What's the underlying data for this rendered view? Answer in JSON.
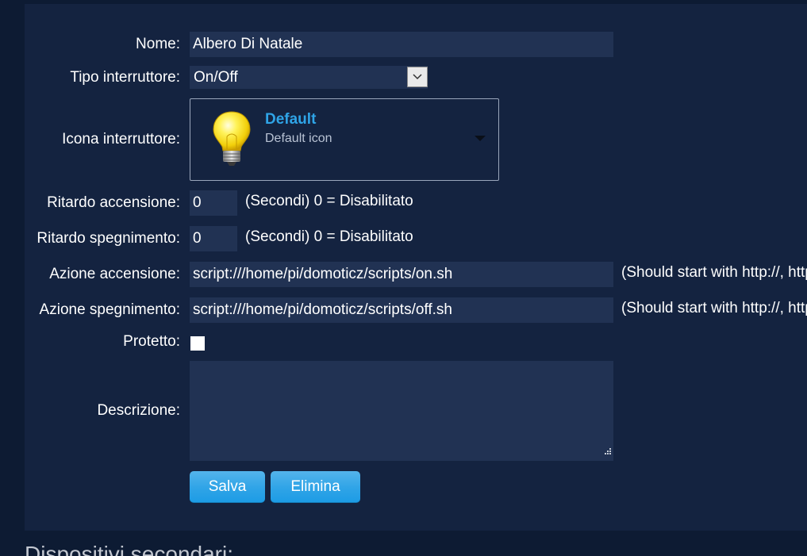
{
  "form": {
    "name_label": "Nome:",
    "name_value": "Albero Di Natale",
    "type_label": "Tipo interruttore:",
    "type_value": "On/Off",
    "icon_label": "Icona interruttore:",
    "icon_title": "Default",
    "icon_subtitle": "Default icon",
    "icon_name": "lightbulb-icon",
    "on_delay_label": "Ritardo accensione:",
    "on_delay_value": "0",
    "on_delay_note": "(Secondi) 0 = Disabilitato",
    "off_delay_label": "Ritardo spegnimento:",
    "off_delay_value": "0",
    "off_delay_note": "(Secondi) 0 = Disabilitato",
    "on_action_label": "Azione accensione:",
    "on_action_value": "script:///home/pi/domoticz/scripts/on.sh",
    "on_action_note": "(Should start with http://, https://, script://)",
    "off_action_label": "Azione spegnimento:",
    "off_action_value": "script:///home/pi/domoticz/scripts/off.sh",
    "off_action_note": "(Should start with http://, https://, script://)",
    "protected_label": "Protetto:",
    "protected_checked": false,
    "description_label": "Descrizione:",
    "description_value": "",
    "save_label": "Salva",
    "delete_label": "Elimina"
  },
  "sub_devices_title": "Dispositivi secondari:",
  "colors": {
    "background": "#0d1b33",
    "panel": "#142340",
    "input": "#213253",
    "accent": "#2fa4e7"
  }
}
